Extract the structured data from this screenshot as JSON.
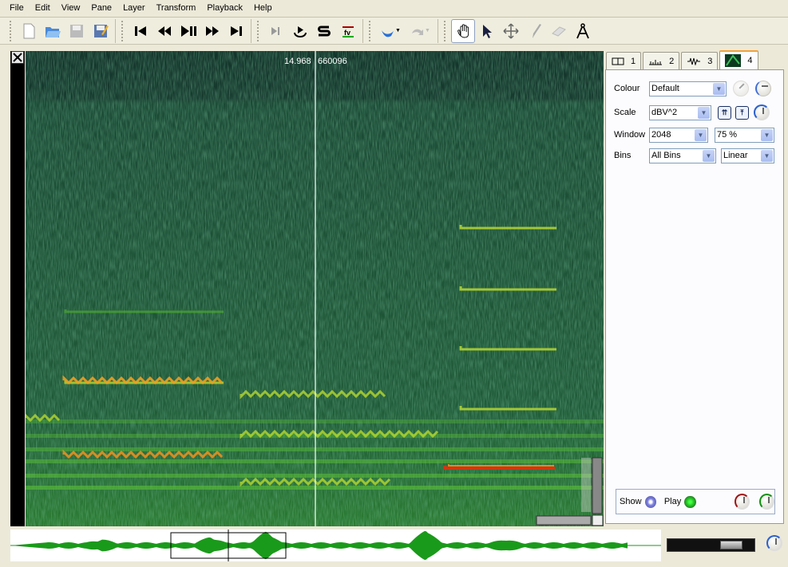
{
  "menu": [
    "File",
    "Edit",
    "View",
    "Pane",
    "Layer",
    "Transform",
    "Playback",
    "Help"
  ],
  "toolbar": {
    "file": [
      "new-file",
      "open-file",
      "save-file",
      "save-as"
    ],
    "transport": [
      "rewind-start",
      "rewind",
      "play-pause",
      "fast-forward",
      "fast-forward-end"
    ],
    "playback_modes": [
      "constrain-playback",
      "loop",
      "solo",
      "follow-playback"
    ],
    "edit": [
      "undo",
      "redo"
    ],
    "tools": [
      "navigate",
      "select",
      "move",
      "draw",
      "erase",
      "measure"
    ],
    "active_tool": "navigate"
  },
  "pane": {
    "time_readout": "14.968",
    "frame_readout": "660096"
  },
  "layer_tabs": [
    {
      "label": "1",
      "icon": "pane-icon"
    },
    {
      "label": "2",
      "icon": "time-ruler-icon"
    },
    {
      "label": "3",
      "icon": "waveform-icon"
    },
    {
      "label": "4",
      "icon": "spectrogram-icon",
      "selected": true
    }
  ],
  "properties": {
    "colour": {
      "label": "Colour",
      "value": "Default"
    },
    "scale": {
      "label": "Scale",
      "value": "dBV^2"
    },
    "window": {
      "label": "Window",
      "value": "2048",
      "overlap": "75 %"
    },
    "bins": {
      "label": "Bins",
      "value": "All Bins",
      "frequency_scale": "Linear"
    },
    "show_label": "Show",
    "play_label": "Play"
  },
  "colors": {
    "spectrogram_bg": "#1e4d36",
    "show_led": "#7b7ee0",
    "play_led": "#22c022",
    "waveform": "#1a9a1a"
  }
}
